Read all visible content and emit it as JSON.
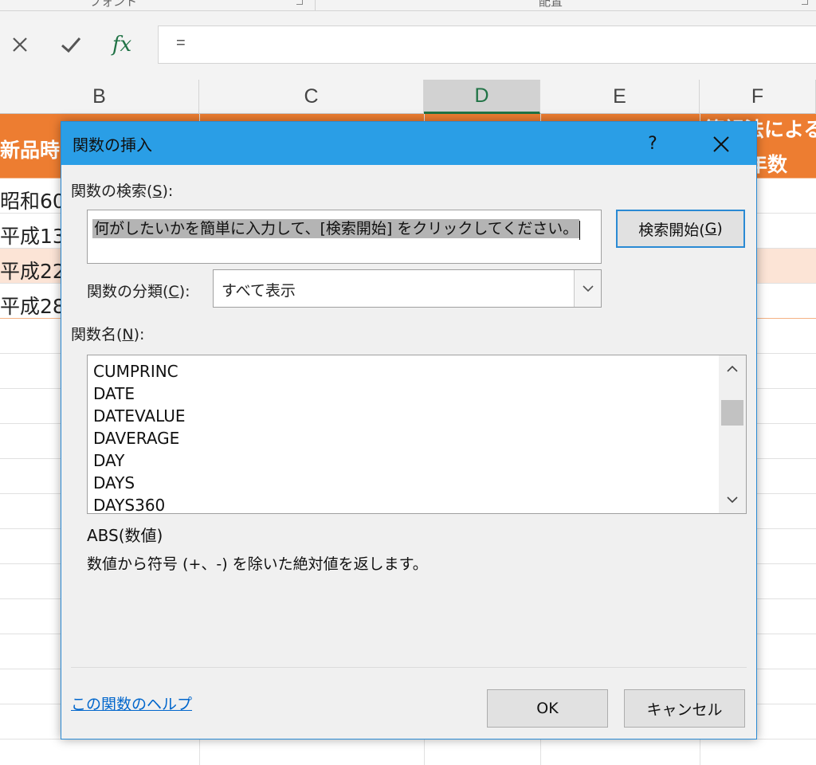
{
  "ribbon": {
    "groups": [
      {
        "label": "フォント"
      },
      {
        "label": "配置"
      }
    ]
  },
  "formula_bar": {
    "cancel_icon": "close-icon",
    "enter_icon": "check-icon",
    "fx_label": "fx",
    "content": "="
  },
  "columns": [
    {
      "label": "B",
      "selected": false
    },
    {
      "label": "C",
      "selected": false
    },
    {
      "label": "D",
      "selected": true
    },
    {
      "label": "E",
      "selected": false
    },
    {
      "label": "F",
      "selected": false
    }
  ],
  "sheet": {
    "header_row": {
      "b": "新品時の",
      "f_line1": "簿記法による",
      "f_line2": "年数"
    },
    "rows": [
      {
        "b": "昭和60"
      },
      {
        "b": "平成13"
      },
      {
        "b": "平成22"
      },
      {
        "b": "平成28"
      }
    ],
    "colors": {
      "header_bg": "#ed7d31",
      "band_bg": "#fce4d6",
      "accent": "#217346"
    }
  },
  "dialog": {
    "title": "関数の挿入",
    "help_glyph": "?",
    "search_label": "関数の検索(",
    "search_label_key": "S",
    "search_label_end": "):",
    "search_text": "何がしたいかを簡単に入力して、[検索開始] をクリックしてください。",
    "search_button": "検索開始(",
    "search_button_key": "G",
    "search_button_end": ")",
    "category_label": "関数の分類(",
    "category_label_key": "C",
    "category_label_end": "):",
    "category_value": "すべて表示",
    "name_label": "関数名(",
    "name_label_key": "N",
    "name_label_end": "):",
    "functions": [
      "CUMPRINC",
      "DATE",
      "DATEVALUE",
      "DAVERAGE",
      "DAY",
      "DAYS",
      "DAYS360"
    ],
    "signature": "ABS(数値)",
    "description": "数値から符号 (+、-) を除いた絶対値を返します。",
    "help_link": "この関数のヘルプ",
    "ok": "OK",
    "cancel": "キャンセル",
    "accent": "#2a9ee6"
  }
}
